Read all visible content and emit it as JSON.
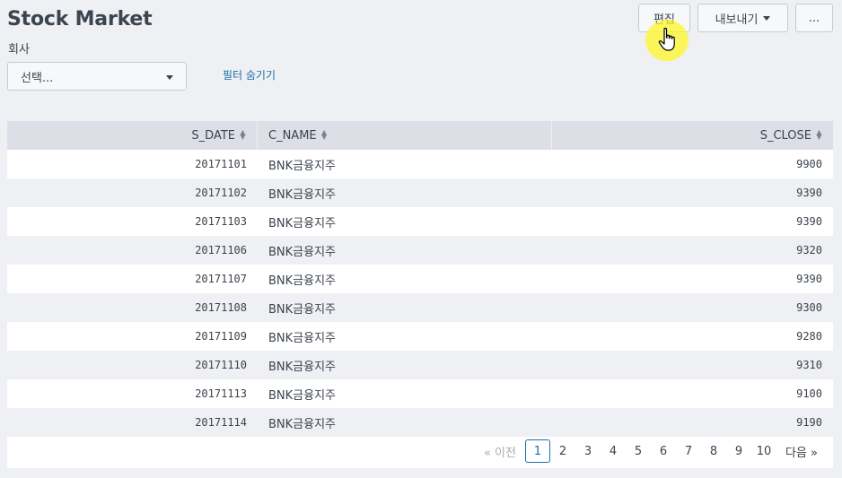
{
  "header": {
    "title": "Stock Market"
  },
  "toolbar": {
    "edit_label": "편집",
    "export_label": "내보내기",
    "more_label": "..."
  },
  "filter": {
    "label": "회사",
    "select_value": "선택...",
    "hide_filters_label": "필터 숨기기"
  },
  "table": {
    "columns": [
      "S_DATE",
      "C_NAME",
      "S_CLOSE"
    ],
    "rows": [
      {
        "date": "20171101",
        "name": "BNK금융지주",
        "close": "9900"
      },
      {
        "date": "20171102",
        "name": "BNK금융지주",
        "close": "9390"
      },
      {
        "date": "20171103",
        "name": "BNK금융지주",
        "close": "9390"
      },
      {
        "date": "20171106",
        "name": "BNK금융지주",
        "close": "9320"
      },
      {
        "date": "20171107",
        "name": "BNK금융지주",
        "close": "9390"
      },
      {
        "date": "20171108",
        "name": "BNK금융지주",
        "close": "9300"
      },
      {
        "date": "20171109",
        "name": "BNK금융지주",
        "close": "9280"
      },
      {
        "date": "20171110",
        "name": "BNK금융지주",
        "close": "9310"
      },
      {
        "date": "20171113",
        "name": "BNK금융지주",
        "close": "9100"
      },
      {
        "date": "20171114",
        "name": "BNK금융지주",
        "close": "9190"
      }
    ]
  },
  "pagination": {
    "prev_label": "« 이전",
    "pages": [
      "1",
      "2",
      "3",
      "4",
      "5",
      "6",
      "7",
      "8",
      "9",
      "10"
    ],
    "current": "1",
    "next_label": "다음 »"
  },
  "colors": {
    "link": "#1a6fa8",
    "header_bg": "#dce0e6",
    "cursor_highlight": "#fff728"
  },
  "icons": {
    "sort": "sort-icon",
    "dropdown": "caret-down-icon",
    "cursor": "hand-cursor-icon"
  }
}
